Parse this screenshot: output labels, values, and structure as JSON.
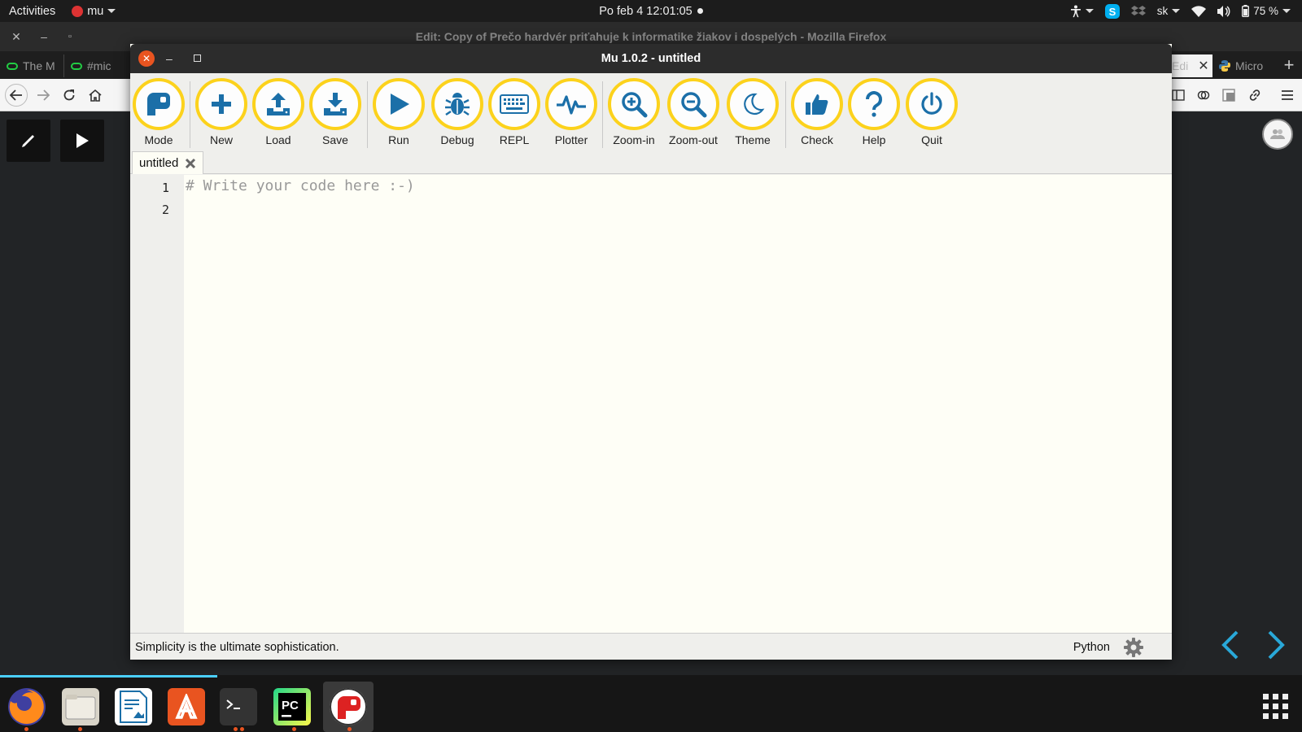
{
  "system_bar": {
    "activities": "Activities",
    "app_name": "mu",
    "clock": "Po feb 4  12:01:05",
    "keyboard_layout": "sk",
    "battery": "75 %"
  },
  "firefox": {
    "window_title": "Edit: Copy of Prečo hardvér priťahuje k informatike žiakov i dospelých - Mozilla Firefox",
    "tabs": [
      {
        "label": "The M"
      },
      {
        "label": "#mic"
      },
      {
        "label": "Edi"
      },
      {
        "label": "Micro"
      }
    ]
  },
  "mu": {
    "window_title": "Mu 1.0.2 - untitled",
    "toolbar": [
      {
        "label": "Mode",
        "icon": "mode-icon"
      },
      {
        "label": "New",
        "icon": "plus-icon"
      },
      {
        "label": "Load",
        "icon": "upload-icon"
      },
      {
        "label": "Save",
        "icon": "download-icon"
      },
      {
        "label": "Run",
        "icon": "play-icon"
      },
      {
        "label": "Debug",
        "icon": "bug-icon"
      },
      {
        "label": "REPL",
        "icon": "keyboard-icon"
      },
      {
        "label": "Plotter",
        "icon": "pulse-icon"
      },
      {
        "label": "Zoom-in",
        "icon": "zoom-in-icon"
      },
      {
        "label": "Zoom-out",
        "icon": "zoom-out-icon"
      },
      {
        "label": "Theme",
        "icon": "moon-icon"
      },
      {
        "label": "Check",
        "icon": "thumbs-up-icon"
      },
      {
        "label": "Help",
        "icon": "question-icon"
      },
      {
        "label": "Quit",
        "icon": "power-icon"
      }
    ],
    "file_tab": "untitled",
    "line_numbers": [
      "1",
      "2"
    ],
    "code": "# Write your code here :-)",
    "status_message": "Simplicity is the ultimate sophistication.",
    "mode": "Python"
  },
  "colors": {
    "accent_yellow": "#fcd21c",
    "ubuntu_orange": "#e95420",
    "icon_blue": "#1b6fa8",
    "teal_arrow": "#29a8d8"
  }
}
